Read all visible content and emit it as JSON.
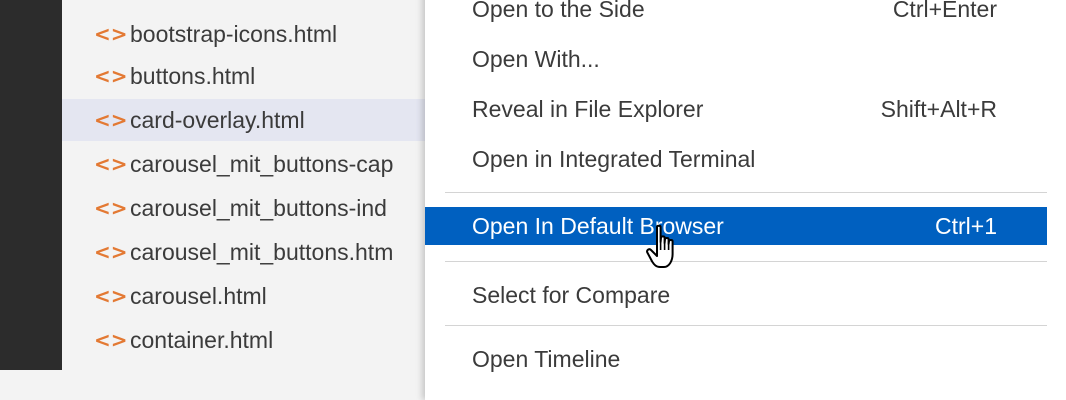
{
  "explorer": {
    "files": [
      {
        "name": "bootstrap-icons.html",
        "icon": "html-icon",
        "selected": false
      },
      {
        "name": "buttons.html",
        "icon": "html-icon",
        "selected": false
      },
      {
        "name": "card-overlay.html",
        "icon": "html-icon",
        "selected": true
      },
      {
        "name": "carousel_mit_buttons-cap",
        "icon": "html-icon",
        "selected": false
      },
      {
        "name": "carousel_mit_buttons-ind",
        "icon": "html-icon",
        "selected": false
      },
      {
        "name": "carousel_mit_buttons.htm",
        "icon": "html-icon",
        "selected": false
      },
      {
        "name": "carousel.html",
        "icon": "html-icon",
        "selected": false
      },
      {
        "name": "container.html",
        "icon": "html-icon",
        "selected": false
      }
    ],
    "icon_glyph": "<>",
    "icon_color": "#e37933"
  },
  "context_menu": {
    "items": [
      {
        "label": "Open to the Side",
        "shortcut": "Ctrl+Enter"
      },
      {
        "label": "Open With...",
        "shortcut": ""
      },
      {
        "label": "Reveal in File Explorer",
        "shortcut": "Shift+Alt+R"
      },
      {
        "label": "Open in Integrated Terminal",
        "shortcut": ""
      },
      {
        "label": "Open In Default Browser",
        "shortcut": "Ctrl+1",
        "active": true
      },
      {
        "label": "Select for Compare",
        "shortcut": ""
      },
      {
        "label": "Open Timeline",
        "shortcut": ""
      }
    ],
    "highlight_color": "#0060c0"
  },
  "cursor": {
    "icon": "hand-pointer-icon"
  }
}
